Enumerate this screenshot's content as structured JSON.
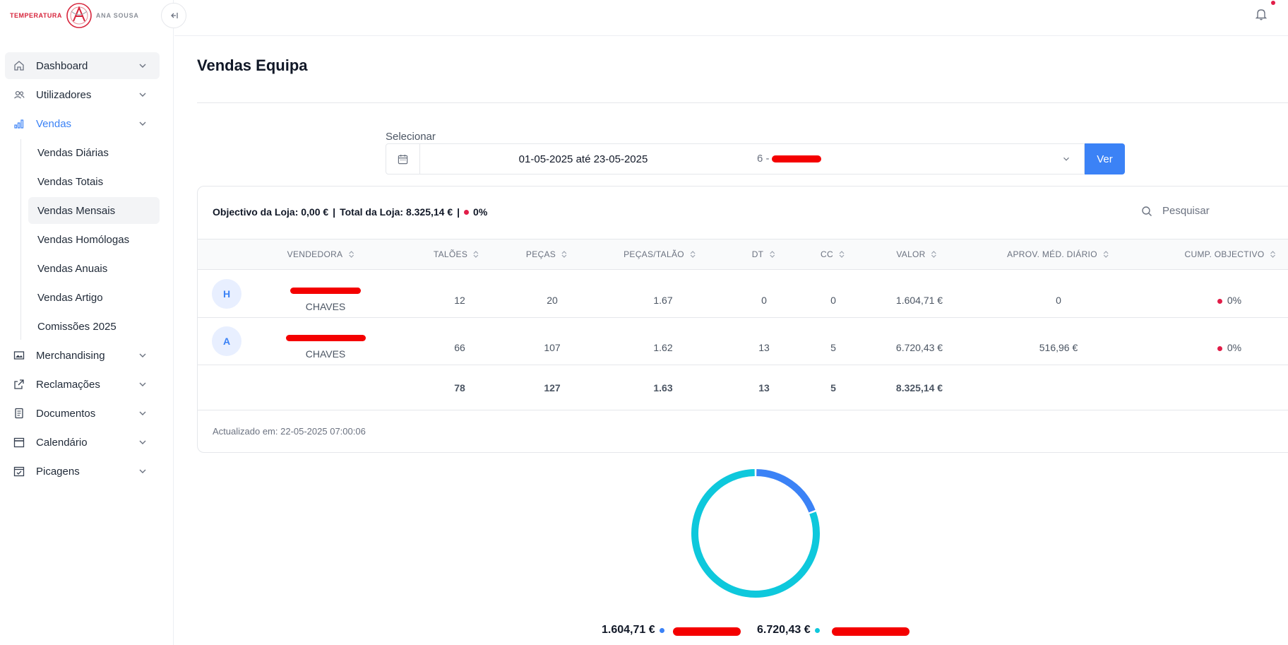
{
  "brand": {
    "left": "TEMPERATURA",
    "right": "ANA SOUSA"
  },
  "sidebar": {
    "items": [
      {
        "label": "Dashboard",
        "icon": "home-icon"
      },
      {
        "label": "Utilizadores",
        "icon": "users-icon"
      },
      {
        "label": "Vendas",
        "icon": "bar-chart-icon"
      }
    ],
    "vendas_sub": [
      "Vendas Diárias",
      "Vendas Totais",
      "Vendas Mensais",
      "Vendas Homólogas",
      "Vendas Anuais",
      "Vendas Artigo",
      "Comissões 2025"
    ],
    "items2": [
      {
        "label": "Merchandising",
        "icon": "image-icon"
      },
      {
        "label": "Reclamações",
        "icon": "external-link-icon"
      },
      {
        "label": "Documentos",
        "icon": "document-icon"
      },
      {
        "label": "Calendário",
        "icon": "calendar-icon"
      },
      {
        "label": "Picagens",
        "icon": "calendar-check-icon"
      }
    ],
    "selected_sub": "Vendas Mensais"
  },
  "page": {
    "title": "Vendas Equipa"
  },
  "filters": {
    "label": "Selecionar",
    "date_range": "01-05-2025 até 23-05-2025",
    "store_value": "6 - ",
    "submit": "Ver"
  },
  "summary": {
    "objective_label": "Objectivo da Loja: 0,00 €",
    "sep1": "|",
    "total_label": "Total da Loja: 8.325,14 €",
    "sep2": "|",
    "percent": "0%"
  },
  "search": {
    "placeholder": "Pesquisar"
  },
  "table": {
    "headers": [
      "VENDEDORA",
      "TALÕES",
      "PEÇAS",
      "PEÇAS/TALÃO",
      "DT",
      "CC",
      "VALOR",
      "APROV. MÉD. DIÁRIO",
      "CUMP. OBJECTIVO"
    ],
    "rows": [
      {
        "initial": "H",
        "store": "CHAVES",
        "taloes": "12",
        "pecas": "20",
        "pecas_talao": "1.67",
        "dt": "0",
        "cc": "0",
        "valor": "1.604,71 €",
        "aprov": "0",
        "cump": "0%"
      },
      {
        "initial": "A",
        "store": "CHAVES",
        "taloes": "66",
        "pecas": "107",
        "pecas_talao": "1.62",
        "dt": "13",
        "cc": "5",
        "valor": "6.720,43 €",
        "aprov": "516,96 €",
        "cump": "0%"
      }
    ],
    "totals": {
      "taloes": "78",
      "pecas": "127",
      "pecas_talao": "1.63",
      "dt": "13",
      "cc": "5",
      "valor": "8.325,14 €"
    }
  },
  "updated": "Actualizado em: 22-05-2025 07:00:06",
  "chart_data": {
    "type": "pie",
    "categories": [
      "H",
      "A"
    ],
    "values": [
      1604.71,
      6720.43
    ],
    "labels": [
      "1.604,71 €",
      "6.720,43 €"
    ],
    "colors": [
      "#3b82f6",
      "#0ec8dc"
    ]
  }
}
